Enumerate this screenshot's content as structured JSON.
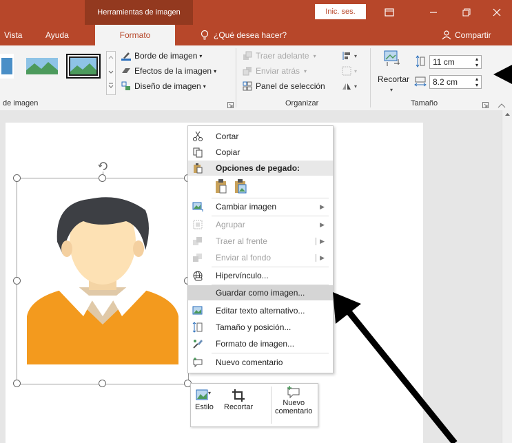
{
  "window": {
    "context_tab_group": "Herramientas de imagen",
    "signin_label": "Inic. ses.",
    "share_label": "Compartir"
  },
  "tabs": {
    "items": [
      "Vista",
      "Ayuda",
      "Formato"
    ],
    "active": "Formato",
    "tell_me": "¿Qué desea hacer?"
  },
  "ribbon": {
    "styles": {
      "border_label": "Borde de imagen",
      "effects_label": "Efectos de la imagen",
      "layout_label": "Diseño de imagen",
      "group_label": "de imagen"
    },
    "arrange": {
      "bring_forward": "Traer adelante",
      "send_backward": "Enviar atrás",
      "selection_pane": "Panel de selección",
      "group_label": "Organizar"
    },
    "size": {
      "crop_label": "Recortar",
      "height_value": "11 cm",
      "width_value": "8.2 cm",
      "group_label": "Tamaño"
    }
  },
  "context_menu": {
    "cut": "Cortar",
    "copy": "Copiar",
    "paste_options": "Opciones de pegado:",
    "change_picture": "Cambiar imagen",
    "group": "Agrupar",
    "bring_front": "Traer al frente",
    "send_back": "Enviar al fondo",
    "hyperlink": "Hipervínculo...",
    "save_as_picture": "Guardar como imagen...",
    "edit_alt_text": "Editar texto alternativo...",
    "size_position": "Tamaño y posición...",
    "format_picture": "Formato de imagen...",
    "new_comment": "Nuevo comentario"
  },
  "mini_toolbar": {
    "style": "Estilo",
    "crop": "Recortar",
    "new_comment_1": "Nuevo",
    "new_comment_2": "comentario"
  },
  "colors": {
    "brand": "#b7472a",
    "brand_dark": "#93391f",
    "ribbon_bg": "#f3f3f3",
    "highlight": "#d5d5d5"
  }
}
